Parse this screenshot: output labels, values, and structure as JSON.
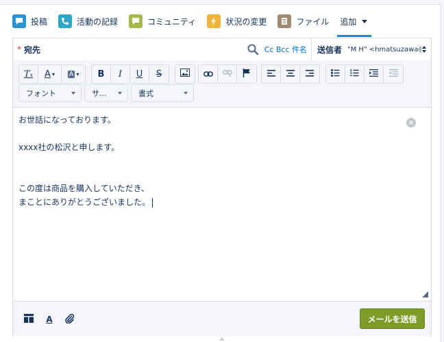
{
  "tabs": [
    {
      "label": "投稿",
      "icon": "post-icon",
      "color": "#2a94d6"
    },
    {
      "label": "活動の記録",
      "icon": "phone-icon",
      "color": "#2fa5c8"
    },
    {
      "label": "コミュニティ",
      "icon": "community-icon",
      "color": "#a5b848"
    },
    {
      "label": "状況の変更",
      "icon": "lightning-icon",
      "color": "#f2b33d"
    },
    {
      "label": "ファイル",
      "icon": "file-icon",
      "color": "#a08a70"
    },
    {
      "label": "追加",
      "icon": "chevron-down-icon"
    }
  ],
  "recipient": {
    "required_mark": "*",
    "to_label": "宛先",
    "cc_bcc_subject": "Cc Bcc 件名",
    "sender_label": "送信者",
    "sender_value": "\"M H\" <hmatsuzawa@"
  },
  "toolbar": {
    "font_label": "フォント",
    "size_label": "サ...",
    "format_label": "書式"
  },
  "body": {
    "lines": [
      "お世話になっております。",
      "",
      "xxxx社の松沢と申します。",
      "",
      "",
      "この度は商品を購入していただき、",
      "まことにありがとうございました。"
    ]
  },
  "footer": {
    "send_label": "メールを送信"
  },
  "colors": {
    "accent": "#1589ee",
    "send_button": "#7f9c28",
    "link": "#0070d2",
    "required": "#c23934"
  }
}
